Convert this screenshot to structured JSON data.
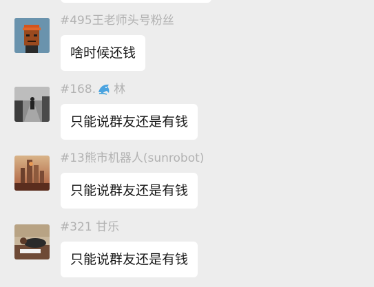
{
  "messages": [
    {
      "sender": "#495王老师头号粉丝",
      "text": "啥时候还钱",
      "avatar_icon": "pixel-punk-avatar-icon"
    },
    {
      "sender_prefix": "#168.",
      "sender_emoji_icon": "dolphin-emoji-icon",
      "sender_suffix": "林",
      "text": "只能说群友还是有钱",
      "avatar_icon": "person-walking-photo-avatar-icon"
    },
    {
      "sender": "#13熊市机器人(sunrobot)",
      "text": "只能说群友还是有钱",
      "avatar_icon": "futuristic-city-avatar-icon"
    },
    {
      "sender": "#321 甘乐",
      "text": "只能说群友还是有钱",
      "avatar_icon": "person-lying-photo-avatar-icon"
    }
  ],
  "colors": {
    "background": "#ededed",
    "bubble": "#ffffff",
    "sender_text": "#b2b2b2",
    "message_text": "#191919"
  }
}
